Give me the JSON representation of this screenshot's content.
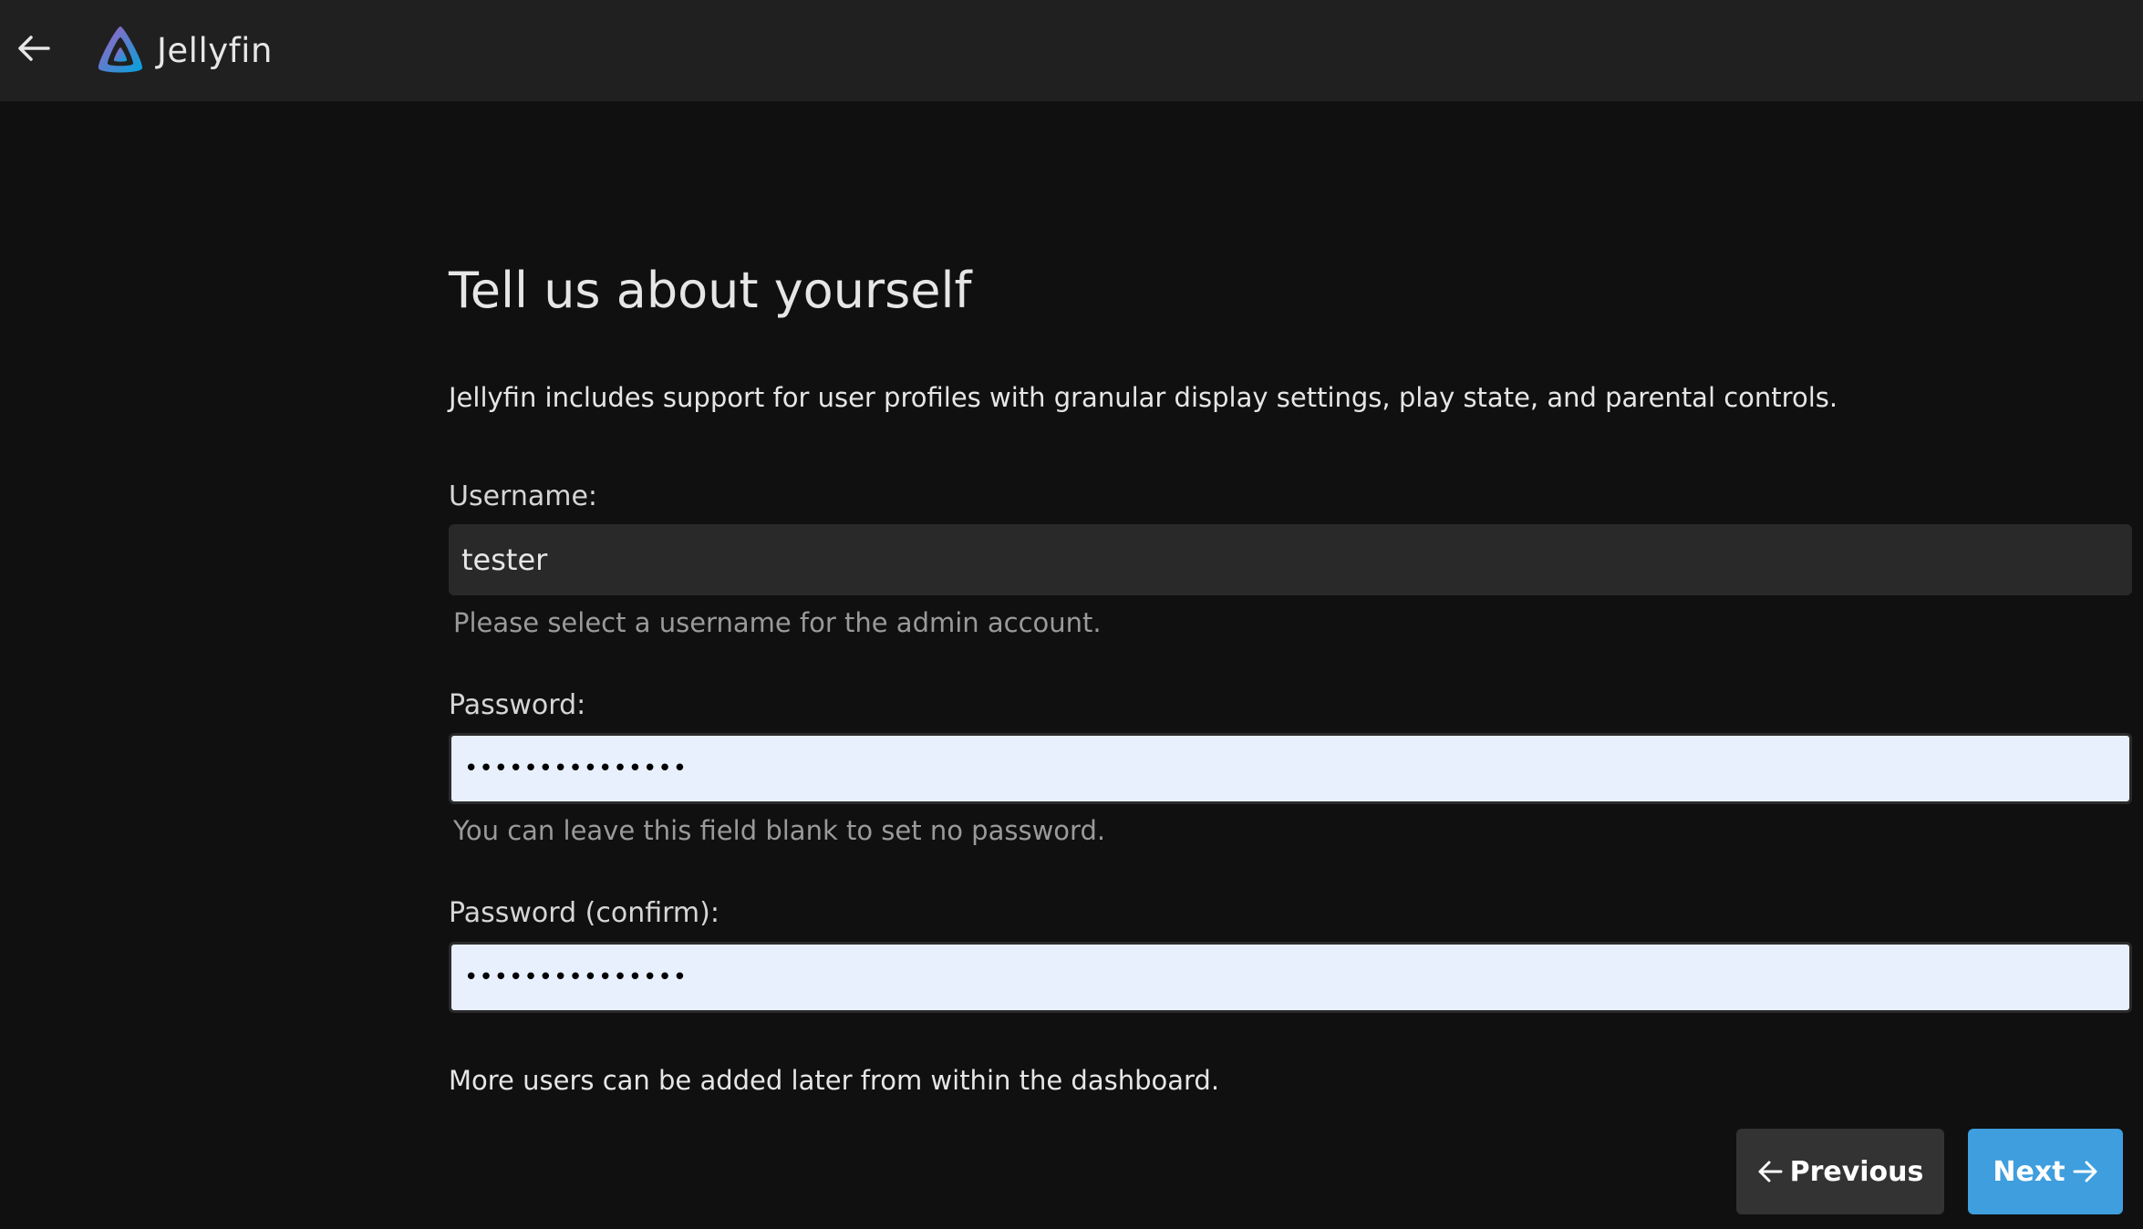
{
  "header": {
    "app_name": "Jellyfin",
    "back_icon": "arrow-left-icon",
    "logo_icon": "jellyfin-logo-icon",
    "background": "#202020"
  },
  "wizard": {
    "title": "Tell us about yourself",
    "intro": "Jellyfin includes support for user profiles with granular display settings, play state, and parental controls.",
    "username": {
      "label": "Username:",
      "value": "tester",
      "hint": "Please select a username for the admin account."
    },
    "password": {
      "label": "Password:",
      "value": "•••••••••••••••",
      "hint": "You can leave this field blank to set no password."
    },
    "password_confirm": {
      "label": "Password (confirm):",
      "value": "•••••••••••••••"
    },
    "footer_note": "More users can be added later from within the dashboard.",
    "buttons": {
      "previous": "Previous",
      "previous_icon": "arrow-left-icon",
      "next": "Next",
      "next_icon": "arrow-right-icon"
    }
  },
  "colors": {
    "page_background": "#101010",
    "accent": "#3e9ede",
    "secondary_button": "#333333",
    "autofill_field": "#e8f0fe"
  }
}
